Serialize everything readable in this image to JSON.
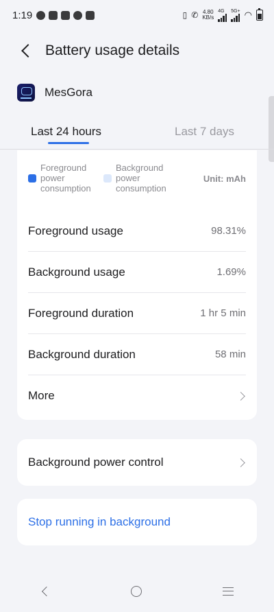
{
  "status_bar": {
    "time": "1:19",
    "speed_value": "4.80",
    "speed_unit": "KB/s",
    "net1": "4G",
    "net2": "5G+"
  },
  "header": {
    "title": "Battery usage details"
  },
  "app": {
    "name": "MesGora"
  },
  "tabs": [
    {
      "label": "Last 24 hours",
      "active": true
    },
    {
      "label": "Last 7 days",
      "active": false
    }
  ],
  "legend": {
    "foreground": "Foreground power consumption",
    "background": "Background power consumption",
    "unit": "Unit: mAh",
    "foreground_color": "#2c6fe6",
    "background_color": "#dce8fb"
  },
  "stats": [
    {
      "label": "Foreground usage",
      "value": "98.31%"
    },
    {
      "label": "Background usage",
      "value": "1.69%"
    },
    {
      "label": "Foreground duration",
      "value": "1 hr 5 min"
    },
    {
      "label": "Background duration",
      "value": "58 min"
    }
  ],
  "more": {
    "label": "More"
  },
  "background_power_control": {
    "label": "Background power control"
  },
  "stop": {
    "label": "Stop running in background"
  }
}
